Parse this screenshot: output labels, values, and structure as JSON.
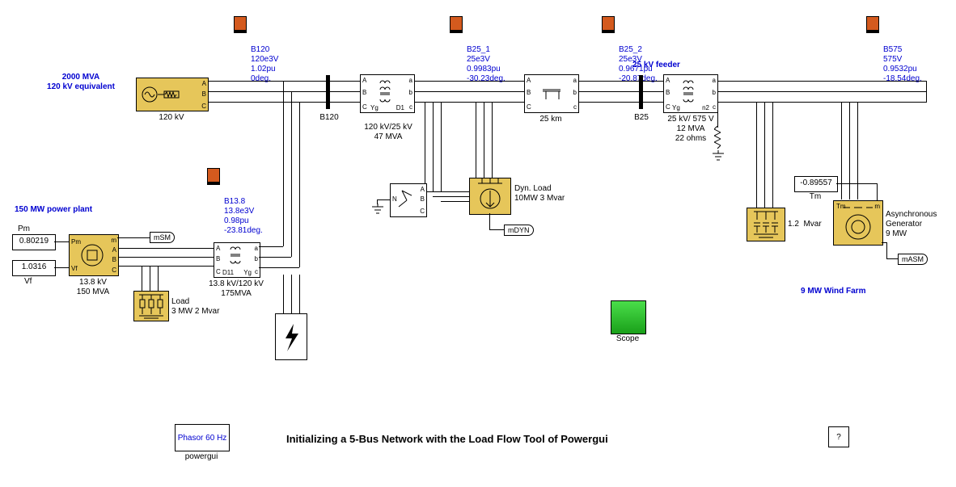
{
  "title": "Initializing a 5-Bus Network with the Load Flow Tool of Powergui",
  "sections": {
    "equivalent": "2000 MVA\n120 kV equivalent",
    "powerplant": "150 MW power plant",
    "feeder": "25 kV feeder",
    "windfarm": "9 MW Wind Farm"
  },
  "blocks": {
    "src120kV": {
      "label": "120 kV"
    },
    "xfmr1": {
      "label": "120 kV/25 kV\n47 MVA"
    },
    "line": {
      "label": "25 km"
    },
    "xfmr2": {
      "label": "25 kV/ 575 V\n12 MVA\n22 ohms"
    },
    "gen": {
      "label1": "13.8 kV",
      "label2": "150 MVA"
    },
    "xfmr3": {
      "label": "13.8 kV/120 kV\n175MVA"
    },
    "load": {
      "label": "Load\n3 MW 2 Mvar"
    },
    "gnd": {
      "label": ""
    },
    "dynload": {
      "label": "Dyn. Load\n10MW 3 Mvar"
    },
    "cap": {
      "label": "1.2  Mvar"
    },
    "asyncgen": {
      "label": "Asynchronous\nGenerator\n9 MW"
    },
    "tm": {
      "value": "-0.89557",
      "label": "Tm"
    },
    "pm": {
      "label": "Pm",
      "value": "0.80219"
    },
    "vf": {
      "label": "Vf",
      "value": "1.0316"
    },
    "powergui": {
      "label": "Phasor\n60 Hz",
      "name": "powergui"
    },
    "scope": {
      "label": "Scope"
    },
    "help": {
      "label": "?"
    }
  },
  "buses": {
    "B120": {
      "name": "B120",
      "v": "120e3V",
      "pu": "1.02pu",
      "deg": "0deg.",
      "barlabel": "B120"
    },
    "B25_1": {
      "name": "B25_1",
      "v": "25e3V",
      "pu": "0.9983pu",
      "deg": "-30.23deg.",
      "barlabel": ""
    },
    "B25_2": {
      "name": "B25_2",
      "v": "25e3V",
      "pu": "0.9671pu",
      "deg": "-20.87deg.",
      "barlabel": "B25"
    },
    "B575": {
      "name": "B575",
      "v": "575V",
      "pu": "0.9532pu",
      "deg": "-18.54deg."
    },
    "B13_8": {
      "name": "B13.8",
      "v": "13.8e3V",
      "pu": "0.98pu",
      "deg": "-23.81deg."
    }
  },
  "tags": {
    "mSM": "mSM",
    "mDYN": "mDYN",
    "mASM": "mASM"
  },
  "ports": {
    "abc_upper": {
      "a": "A",
      "b": "B",
      "c": "C"
    },
    "abc_lower": {
      "a": "a",
      "b": "b",
      "c": "c"
    },
    "yg": "Yg",
    "d1": "D1",
    "d11": "D11",
    "n": "N",
    "n2": "n2",
    "pm_in": "Pm",
    "vf_in": "Vf",
    "m_out": "m",
    "tm_in": "Tm"
  }
}
